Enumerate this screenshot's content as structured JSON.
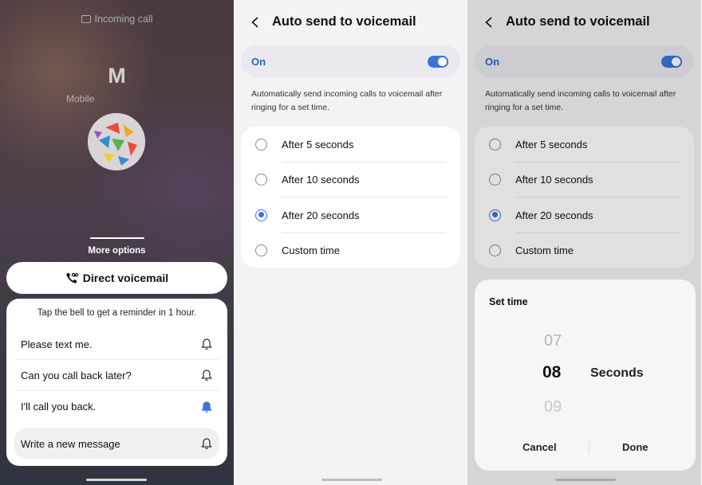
{
  "incoming_call": {
    "label": "Incoming call",
    "caller_initial": "M",
    "caller_type": "Mobile",
    "more_options": "More options",
    "direct_voicemail": "Direct voicemail",
    "reminder_hint": "Tap the bell to get a reminder in 1 hour.",
    "messages": [
      {
        "text": "Please text me.",
        "bell_active": false
      },
      {
        "text": "Can you call back later?",
        "bell_active": false
      },
      {
        "text": "I'll call you back.",
        "bell_active": true
      }
    ],
    "new_message": "Write a new message"
  },
  "settings": {
    "title": "Auto send to voicemail",
    "toggle_label": "On",
    "toggle_on": true,
    "description": "Automatically send incoming calls to voicemail after ringing for a set time.",
    "options": [
      {
        "label": "After 5 seconds",
        "selected": false
      },
      {
        "label": "After 10 seconds",
        "selected": false
      },
      {
        "label": "After 20 seconds",
        "selected": true
      },
      {
        "label": "Custom time",
        "selected": false
      }
    ]
  },
  "set_time": {
    "title": "Set time",
    "prev_value": "07",
    "current_value": "08",
    "next_value": "09",
    "unit": "Seconds",
    "cancel": "Cancel",
    "done": "Done"
  },
  "colors": {
    "accent": "#3b73d9",
    "on_text": "#2c64c4",
    "active_bell": "#3b73d9"
  }
}
